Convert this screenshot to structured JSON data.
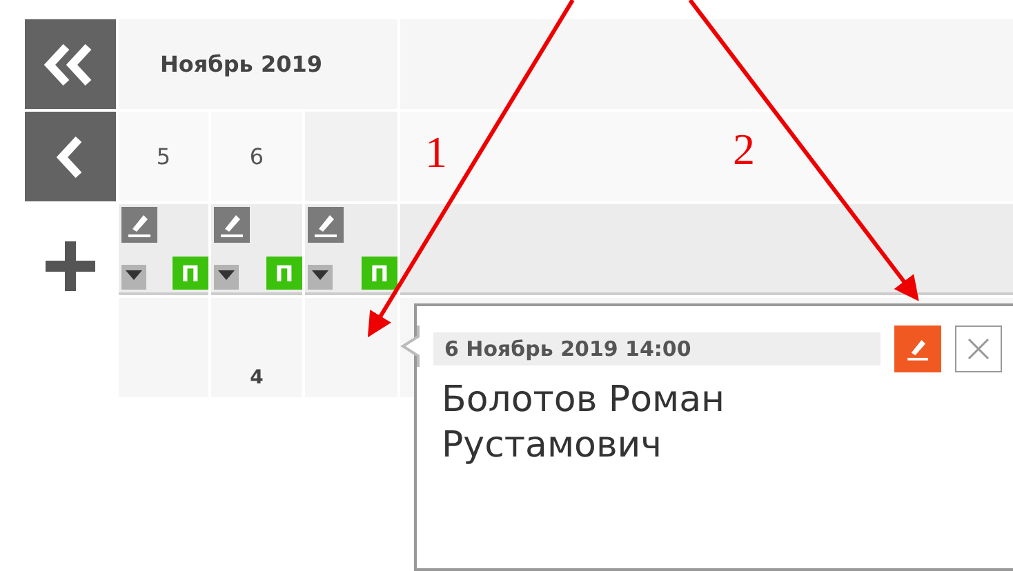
{
  "calendar": {
    "month": "Ноябрь 2019",
    "days": [
      {
        "kind": "day",
        "value": "5"
      },
      {
        "kind": "day",
        "value": "6"
      },
      {
        "kind": "empty"
      }
    ],
    "day_tools": [
      {
        "badge": "П"
      },
      {
        "badge": "П"
      },
      {
        "badge": "П"
      }
    ],
    "row": [
      {
        "kind": "empty"
      },
      {
        "kind": "count",
        "value": "4"
      },
      {
        "kind": "empty"
      }
    ]
  },
  "popup": {
    "datetime": "6 Ноябрь 2019 14:00",
    "name": "Болотов Роман Рустамович"
  },
  "annotations": [
    {
      "label": "1"
    },
    {
      "label": "2"
    }
  ]
}
